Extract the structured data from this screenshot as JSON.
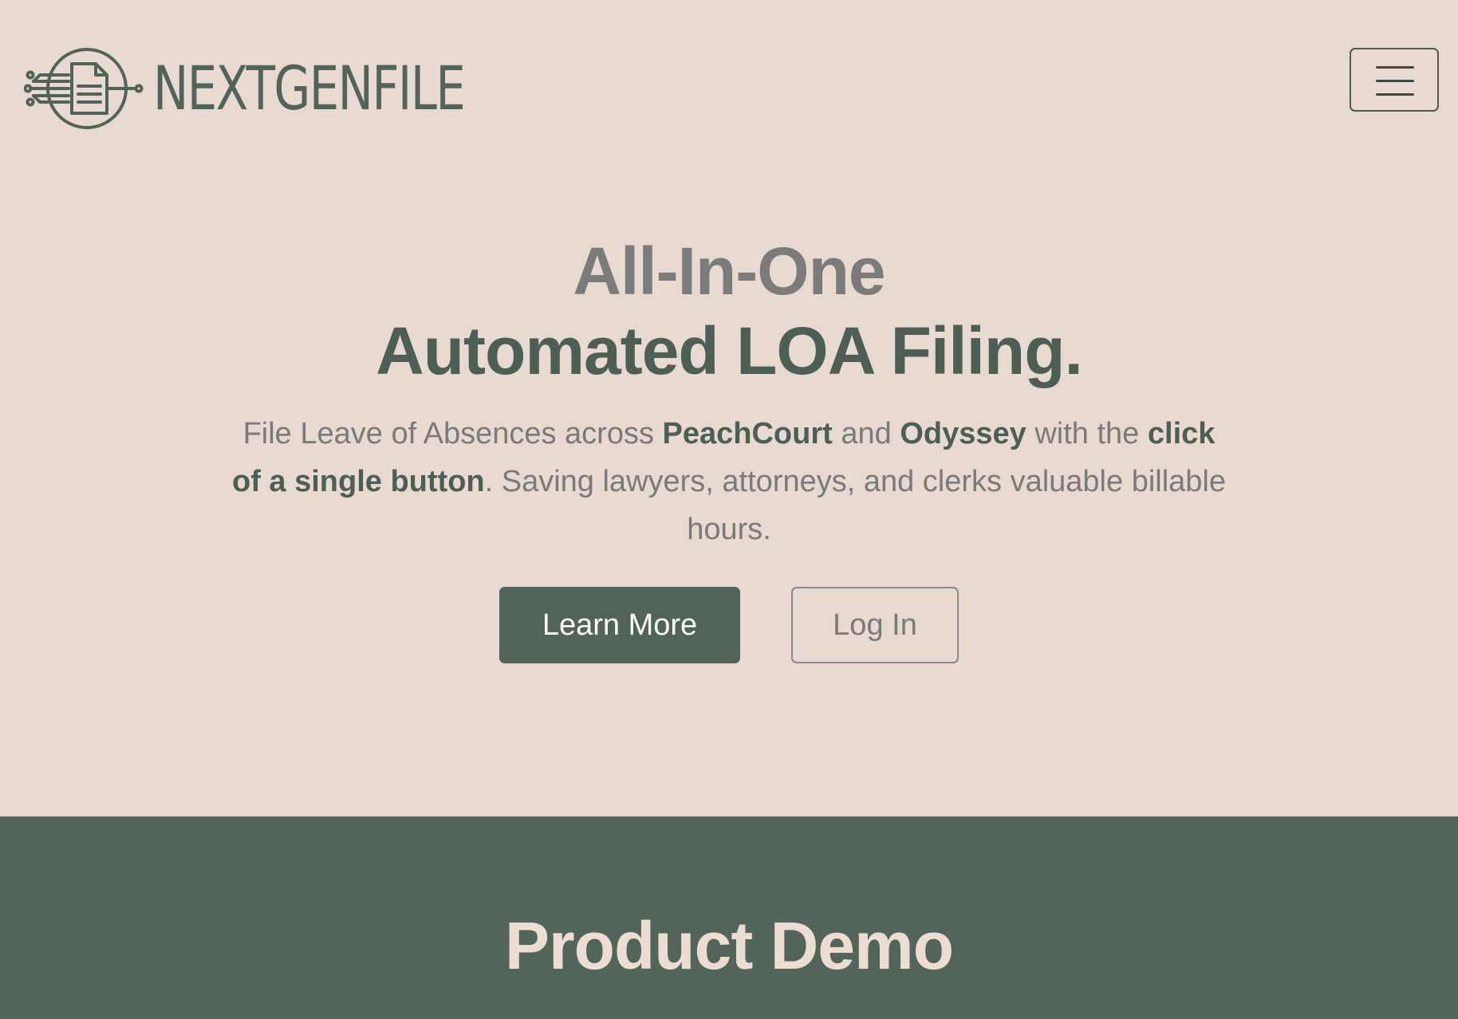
{
  "header": {
    "brand_name": "NEXTGENFILE",
    "logo_icon": "document-circuit-icon",
    "menu_icon": "hamburger-menu-icon"
  },
  "hero": {
    "title_line1": "All-In-One",
    "title_line2": "Automated LOA Filing.",
    "subtitle": {
      "part1": "File Leave of Absences across ",
      "bold1": "PeachCourt",
      "part2": " and ",
      "bold2": "Odyssey",
      "part3": " with the ",
      "bold3": "click of a single button",
      "part4": ". Saving lawyers, attorneys, and clerks valuable billable hours."
    },
    "learn_more_label": "Learn More",
    "login_label": "Log In"
  },
  "demo": {
    "title": "Product Demo"
  },
  "colors": {
    "background": "#e8dad0",
    "brand_green": "#526359",
    "muted_gray": "#7a7a7a",
    "demo_text": "#ecdcd2"
  }
}
